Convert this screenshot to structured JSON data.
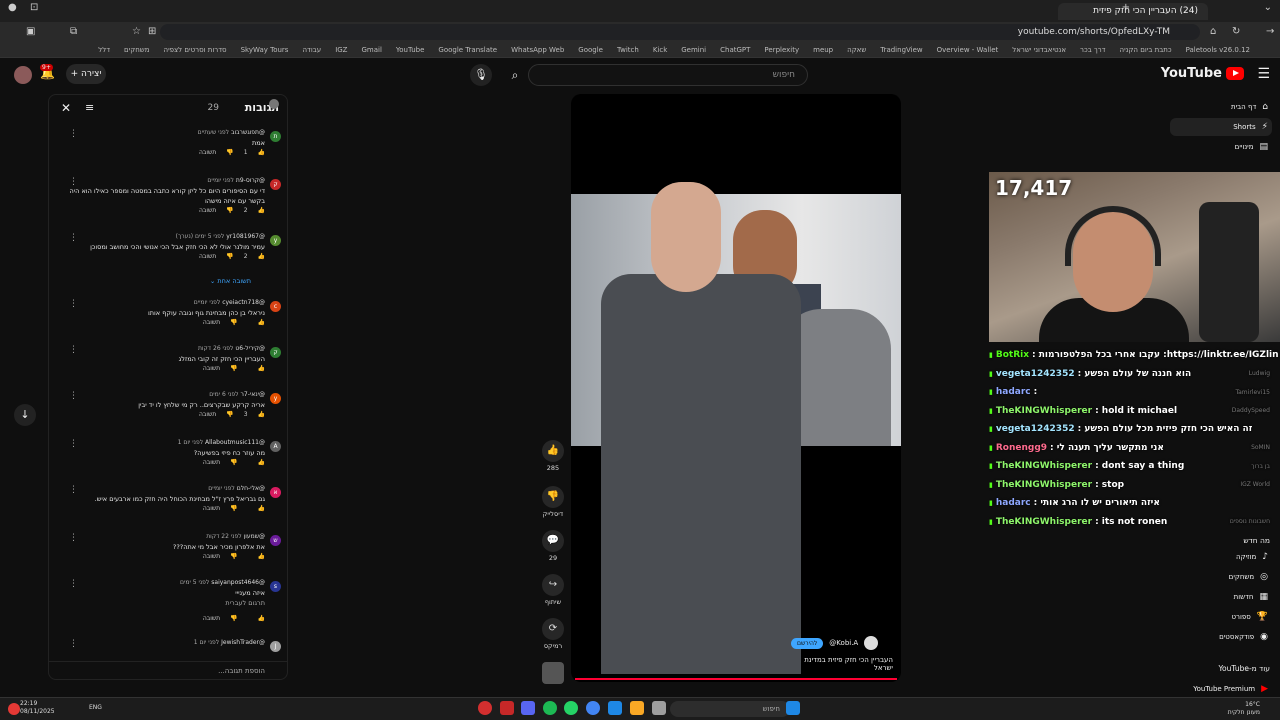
{
  "browser": {
    "tab_title": "(24) העבריין הכי חזק פיזית",
    "url": "youtube.com/shorts/OpfedLXy-TM",
    "bookmarks": [
      "Paletools v26.0.12",
      "כתבת ביום הקניה",
      "דרך בכר",
      "אנטיאבדוני ישראל",
      "Overview - Wallet",
      "TradingView",
      "שאקה",
      "meup",
      "Perplexity",
      "ChatGPT",
      "Gemini",
      "Kick",
      "Twitch",
      "Google",
      "WhatsApp Web",
      "Google Translate",
      "YouTube",
      "Gmail",
      "IGZ",
      "עבודה",
      "SkyWay Tours",
      "סדרות וסרטים לצפיה",
      "משחקים",
      "דלל"
    ]
  },
  "header": {
    "logo_text": "YouTube",
    "logo_sup": "IL",
    "search_placeholder": "חיפוש",
    "create_label": "יצירה",
    "bell_badge": "9+"
  },
  "sidebar": {
    "items": [
      {
        "label": "דף הבית",
        "icon": "home-icon"
      },
      {
        "label": "Shorts",
        "icon": "shorts-icon"
      },
      {
        "label": "מינויים",
        "icon": "subscriptions-icon"
      }
    ],
    "explore_title": "מה חדש",
    "explore": [
      {
        "label": "מוזיקה",
        "icon": "music-icon"
      },
      {
        "label": "משחקים",
        "icon": "gaming-icon"
      },
      {
        "label": "חדשות",
        "icon": "news-icon"
      },
      {
        "label": "ספורט",
        "icon": "sports-icon"
      },
      {
        "label": "פודקאסטים",
        "icon": "podcast-icon"
      }
    ],
    "more_title": "עוד מ-YouTube",
    "premium": "YouTube Premium"
  },
  "comments": {
    "title": "תגובות",
    "count": "29",
    "more_replies": "תשובה אחת",
    "add_placeholder": "הוספת תגובה...",
    "items": [
      {
        "author": "@תפוגשרבוב",
        "time": "לפני שעתיים",
        "text": "אמת",
        "likes": "1",
        "reply": "תשובה",
        "avatar_color": "#2e7d32",
        "avatar_letter": "ת"
      },
      {
        "author": "@קרוס-9ת",
        "time": "לפני יומיים",
        "text": "די עם הסיפורים היום כל ליזן קורא כתבה במסטה ומספר כאילו הוא היה בקשר עם איזה מישהו",
        "likes": "2",
        "reply": "תשובה",
        "avatar_color": "#c62828",
        "avatar_letter": "ק"
      },
      {
        "author": "@yr1081967",
        "time": "לפני 5 ימים (נערך)",
        "text": "עמיר מולנר אולי לא הכי חזק אבל הכי אנושי והכי מחושב ומסוכן",
        "likes": "2",
        "reply": "תשובה",
        "avatar_color": "#558b2f",
        "avatar_letter": "y"
      },
      {
        "author": "@cyeiactn718",
        "time": "לפני יומיים",
        "text": "ניראלי בן כהן מבחינת גוף וגובה עוקף אותו",
        "likes": "",
        "reply": "תשובה",
        "avatar_color": "#d84315",
        "avatar_letter": "c"
      },
      {
        "author": "@קיריל-6ט",
        "time": "לפני 26 דקות",
        "text": "העבריין הכי חזק זה קובי המזלג",
        "likes": "",
        "reply": "תשובה",
        "avatar_color": "#2e7d32",
        "avatar_letter": "ק"
      },
      {
        "author": "@ינאי-7ר",
        "time": "לפני 6 ימים",
        "text": "אריה קרקע שבקרצים.. רק מי שלחץ לו יד יבין",
        "likes": "3",
        "reply": "תשובה",
        "avatar_color": "#e65100",
        "avatar_letter": "y"
      },
      {
        "author": "@Allaboutmusic111",
        "time": "לפני יום 1",
        "text": "מה עוזר כח פיזי בפשיעה?",
        "likes": "",
        "reply": "תשובה",
        "avatar_color": "#616161",
        "avatar_letter": "A"
      },
      {
        "author": "@אלי-חלם",
        "time": "לפני יומיים",
        "text": "גם גבריאל פרץ ז\"ל מבחינת הכוחל היה חזק כמו ארבעים איש.",
        "likes": "",
        "reply": "תשובה",
        "avatar_color": "#d81b60",
        "avatar_letter": "א"
      },
      {
        "author": "@שמעון",
        "time": "לפני 22 דקות",
        "text": "את אלפרון מכיר אבל מי אתה???",
        "likes": "",
        "reply": "תשובה",
        "avatar_color": "#6a1b9a",
        "avatar_letter": "ש"
      },
      {
        "author": "@saiyanpost4646",
        "time": "לפני 5 ימים",
        "text": "איזה מענייי",
        "sub": "תרגום לעברית",
        "likes": "",
        "reply": "תשובה",
        "avatar_color": "#283593",
        "avatar_letter": "s"
      },
      {
        "author": "@JewishTrader",
        "time": "לפני יום 1",
        "text": "",
        "likes": "",
        "reply": "",
        "avatar_color": "#9e9e9e",
        "avatar_letter": "J"
      }
    ]
  },
  "video": {
    "channel": "@Kobi.A",
    "subscribe_label": "להירשם",
    "title": "העבריין הכי חזק פיזית במדינת ישראל",
    "progress": 1.0
  },
  "actions": {
    "likes": "285",
    "dislike_label": "דיסלייק",
    "comments": "29",
    "share_label": "שיתוף",
    "remix_label": "רמיקס"
  },
  "stream": {
    "viewer_count": "17,417",
    "chat": [
      {
        "user": "BotRix",
        "color": "#53fc18",
        "msg": "עקבו אחרי בכל הפלטפורמות :https://linktr.ee/IGZlin",
        "side": ""
      },
      {
        "user": "vegeta1242352",
        "color": "#a4e5ff",
        "msg": "הוא חננה של עולם הפשע",
        "side": "Ludwig"
      },
      {
        "user": "hadarc",
        "color": "#8fa8ff",
        "msg": "",
        "side": "Tamirlevi15"
      },
      {
        "user": "TheKINGWhisperer",
        "color": "#8ef56b",
        "msg": "hold it michael",
        "side": "DaddySpeed"
      },
      {
        "user": "vegeta1242352",
        "color": "#a4e5ff",
        "msg": "זה האיש הכי חזק פיזית מכל עולם הפשע",
        "side": ""
      },
      {
        "user": "Ronengg9",
        "color": "#ff6b8e",
        "msg": "אני מתקשר עליך תענה לי",
        "side": "SoMIN"
      },
      {
        "user": "TheKINGWhisperer",
        "color": "#8ef56b",
        "msg": "dont say a thing",
        "side": "בן ברוך"
      },
      {
        "user": "TheKINGWhisperer",
        "color": "#8ef56b",
        "msg": "stop",
        "side": "IGZ World"
      },
      {
        "user": "hadarc",
        "color": "#8fa8ff",
        "msg": "איזה תיאורים יש לו הרג אותי",
        "side": ""
      },
      {
        "user": "TheKINGWhisperer",
        "color": "#8ef56b",
        "msg": "its not ronen",
        "side": "חשבונות נוספים"
      }
    ]
  },
  "taskbar": {
    "time": "22:19",
    "date": "08/11/2025",
    "lang": "ENG",
    "search_placeholder": "חיפוש",
    "weather_temp": "16°C",
    "weather_desc": "מעונן חלקית"
  }
}
